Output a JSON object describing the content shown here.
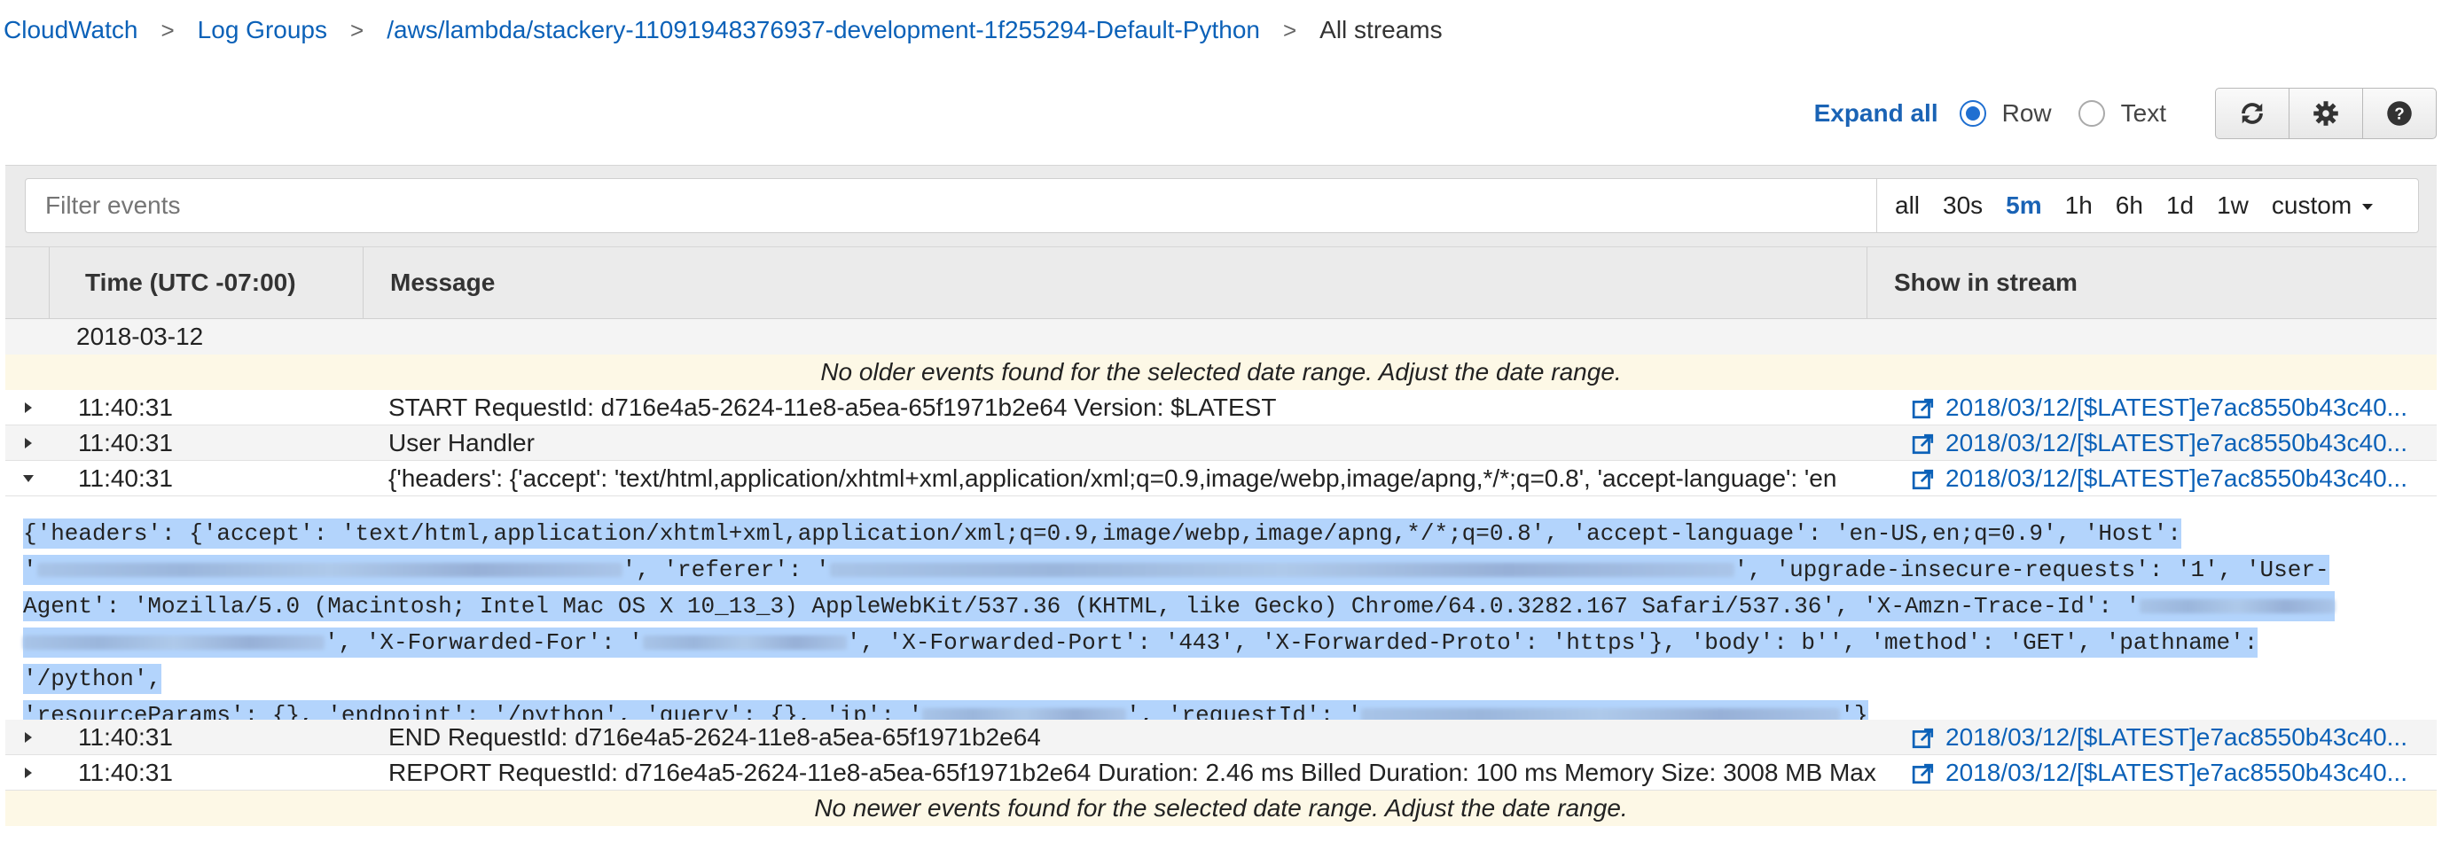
{
  "breadcrumb": {
    "items": [
      "CloudWatch",
      "Log Groups",
      "/aws/lambda/stackery-11091948376937-development-1f255294-Default-Python"
    ],
    "current": "All streams",
    "separator": ">"
  },
  "toolbar": {
    "expand_all": "Expand all",
    "view_options": [
      {
        "label": "Row",
        "selected": true
      },
      {
        "label": "Text",
        "selected": false
      }
    ],
    "buttons": [
      "refresh-icon",
      "gear-icon",
      "help-icon"
    ]
  },
  "filter": {
    "placeholder": "Filter events",
    "ranges": [
      "all",
      "30s",
      "5m",
      "1h",
      "6h",
      "1d",
      "1w"
    ],
    "active_range": "5m",
    "custom_label": "custom"
  },
  "table": {
    "headers": {
      "time": "Time (UTC -07:00)",
      "message": "Message",
      "stream": "Show in stream"
    },
    "date": "2018-03-12",
    "notice_older": "No older events found for the selected date range. Adjust the date range.",
    "notice_newer": "No newer events found for the selected date range. Adjust the date range.",
    "rows_before": [
      {
        "time": "11:40:31",
        "message": "START RequestId: d716e4a5-2624-11e8-a5ea-65f1971b2e64 Version: $LATEST",
        "stream": "2018/03/12/[$LATEST]e7ac8550b43c40..."
      },
      {
        "time": "11:40:31",
        "message": "User Handler",
        "stream": "2018/03/12/[$LATEST]e7ac8550b43c40..."
      },
      {
        "time": "11:40:31",
        "message": "{'headers': {'accept': 'text/html,application/xhtml+xml,application/xml;q=0.9,image/webp,image/apng,*/*;q=0.8', 'accept-language': 'en",
        "stream": "2018/03/12/[$LATEST]e7ac8550b43c40..."
      }
    ],
    "expanded": {
      "l1": "{'headers': {'accept': 'text/html,application/xhtml+xml,application/xml;q=0.9,image/webp,image/apng,*/*;q=0.8', 'accept-language': 'en-US,en;q=0.9', 'Host':",
      "l2a": "'",
      "l2b": "', 'referer': '",
      "l2c": "', 'upgrade-insecure-requests': '1', 'User-",
      "l3a": "Agent': 'Mozilla/5.0 (Macintosh; Intel Mac OS X 10_13_3) AppleWebKit/537.36 (KHTML, like Gecko) Chrome/64.0.3282.167 Safari/537.36', 'X-Amzn-Trace-Id': '",
      "l4b": "', 'X-Forwarded-For': '",
      "l4c": "', 'X-Forwarded-Port': '443', 'X-Forwarded-Proto': 'https'}, 'body': b'', 'method': 'GET', 'pathname': '/python',",
      "l5a": "'resourceParams': {}, 'endpoint': '/python', 'query': {}, 'ip': '",
      "l5b": "', 'requestId': '",
      "l5c": "'}"
    },
    "rows_after": [
      {
        "time": "11:40:31",
        "message": "END RequestId: d716e4a5-2624-11e8-a5ea-65f1971b2e64",
        "stream": "2018/03/12/[$LATEST]e7ac8550b43c40..."
      },
      {
        "time": "11:40:31",
        "message": "REPORT RequestId: d716e4a5-2624-11e8-a5ea-65f1971b2e64 Duration: 2.46 ms Billed Duration: 100 ms Memory Size: 3008 MB Max",
        "stream": "2018/03/12/[$LATEST]e7ac8550b43c40..."
      }
    ]
  },
  "colors": {
    "link": "#0b61b8",
    "highlight": "#b3d4fc",
    "notice_bg": "#fdf8e6",
    "header_bg": "#ebebeb"
  }
}
